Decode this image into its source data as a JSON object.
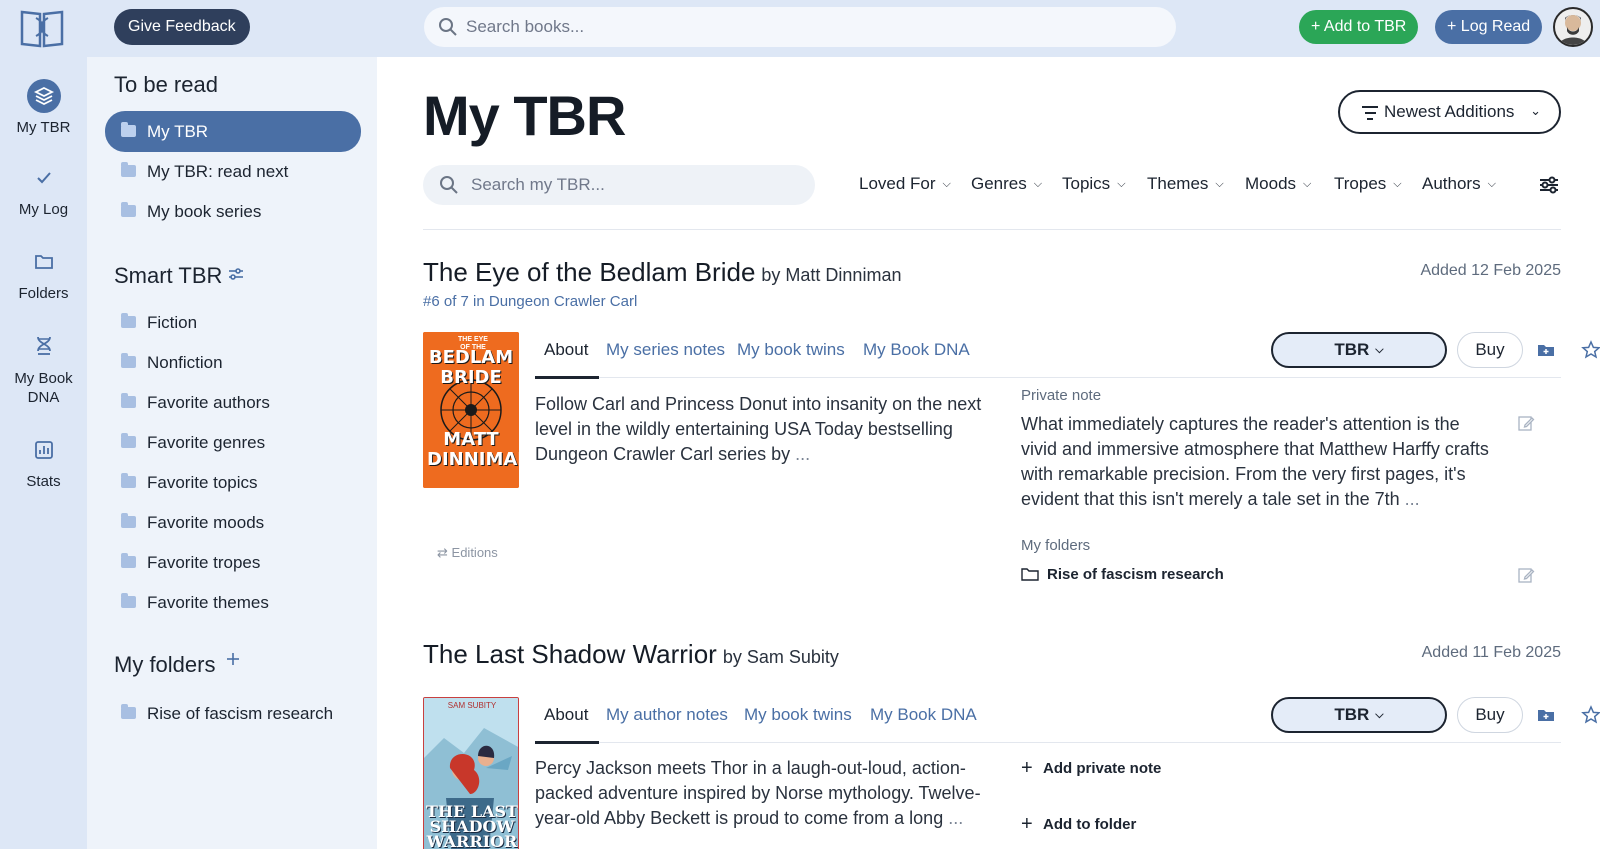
{
  "topbar": {
    "feedback_label": "Give Feedback",
    "search_placeholder": "Search books...",
    "add_tbr_label": "+ Add to TBR",
    "log_read_label": "+ Log Read"
  },
  "rail": {
    "items": [
      {
        "label": "My TBR",
        "icon": "layers-icon"
      },
      {
        "label": "My Log",
        "icon": "check-icon"
      },
      {
        "label": "Folders",
        "icon": "folder-icon"
      },
      {
        "label": "My Book DNA",
        "icon": "dna-icon"
      },
      {
        "label": "Stats",
        "icon": "chart-icon"
      }
    ]
  },
  "sidebar": {
    "tbr_heading": "To be read",
    "tbr_items": [
      "My TBR",
      "My TBR: read next",
      "My book series"
    ],
    "smart_heading": "Smart TBR",
    "smart_items": [
      "Fiction",
      "Nonfiction",
      "Favorite authors",
      "Favorite genres",
      "Favorite topics",
      "Favorite moods",
      "Favorite tropes",
      "Favorite themes"
    ],
    "folders_heading": "My folders",
    "folder_items": [
      "Rise of fascism research"
    ]
  },
  "main": {
    "title": "My TBR",
    "sort_label": "Newest Additions",
    "search_placeholder": "Search my TBR...",
    "filters": [
      "Loved For",
      "Genres",
      "Topics",
      "Themes",
      "Moods",
      "Tropes",
      "Authors"
    ]
  },
  "books": [
    {
      "title": "The Eye of the Bedlam Bride",
      "author": "by Matt Dinniman",
      "series": "#6 of 7 in Dungeon Crawler Carl",
      "added": "Added 12 Feb 2025",
      "tabs": [
        "About",
        "My series notes",
        "My book twins",
        "My Book DNA"
      ],
      "status": "TBR",
      "buy": "Buy",
      "editions": "Editions",
      "description": "Follow Carl and Princess Donut into insanity on the next level in the wildly entertaining USA Today bestselling Dungeon Crawler Carl series by",
      "more": "...",
      "note_label": "Private note",
      "note": "What immediately captures the reader's attention is the vivid and immersive atmosphere that Matthew Harffy crafts with remarkable precision. From the very first pages, it's evident that this isn't merely a tale set in the 7th",
      "folders_label": "My folders",
      "folder": "Rise of fascism research",
      "cover_text": {
        "top": "THE EYE OF THE",
        "title": "BEDLAM BRIDE",
        "author": "MATT DINNIMAN"
      }
    },
    {
      "title": "The Last Shadow Warrior",
      "author": "by Sam Subity",
      "added": "Added 11 Feb 2025",
      "tabs": [
        "About",
        "My author notes",
        "My book twins",
        "My Book DNA"
      ],
      "status": "TBR",
      "buy": "Buy",
      "description": "Percy Jackson meets Thor in a laugh-out-loud, action-packed adventure inspired by Norse mythology. Twelve-year-old Abby Beckett is proud to come from a long",
      "more": "...",
      "add_note": "Add private note",
      "add_folder": "Add to folder",
      "cover_text": {
        "author": "SAM SUBITY",
        "title": "THE LAST SHADOW WARRIOR"
      }
    }
  ],
  "colors": {
    "accent": "#4a6fa5",
    "green": "#2ba657",
    "rail_bg": "#dde7f6",
    "sidebar_bg": "#eef3fa"
  }
}
